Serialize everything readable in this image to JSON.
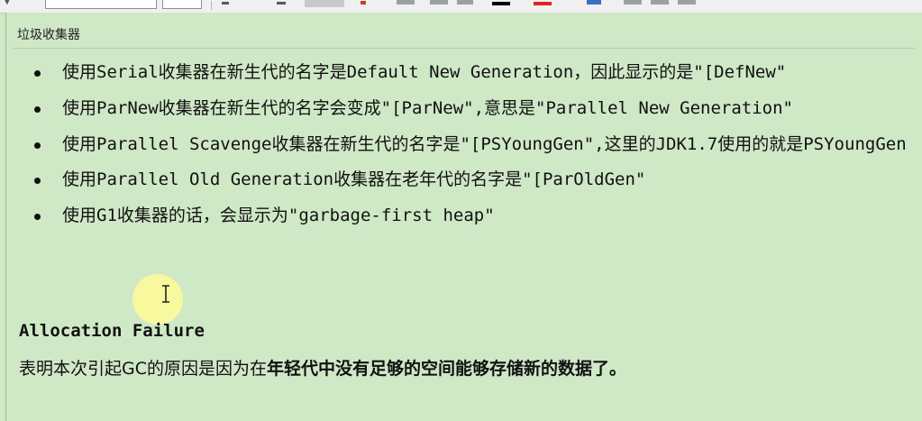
{
  "toolbar": {
    "icons": [
      "dropdown-arrow-icon",
      "font-name-input",
      "font-size-input",
      "format-icon",
      "highlight-icon",
      "text-color-icon",
      "insert-icon"
    ],
    "colors": {
      "text_black": "#000000",
      "text_red": "#e02222"
    }
  },
  "panel": {
    "title": "垃圾收集器",
    "bullets": [
      "使用Serial收集器在新生代的名字是Default New Generation，因此显示的是\"[DefNew\"",
      "使用ParNew收集器在新生代的名字会变成\"[ParNew\",意思是\"Parallel New Generation\"",
      "使用Parallel Scavenge收集器在新生代的名字是\"[PSYoungGen\",这里的JDK1.7使用的就是PSYoungGen",
      "使用Parallel Old Generation收集器在老年代的名字是\"[ParOldGen\"",
      "使用G1收集器的话，会显示为\"garbage-first heap\""
    ],
    "section_heading": "Allocation Failure",
    "section_body_prefix": "表明本次引起GC的原因是因为在",
    "section_body_bold": "年轻代中没有足够的空间能够存储新的数据了。"
  },
  "colors": {
    "background": "#cfe8c6",
    "text": "#111111",
    "cursor_highlight": "#fffa96"
  }
}
